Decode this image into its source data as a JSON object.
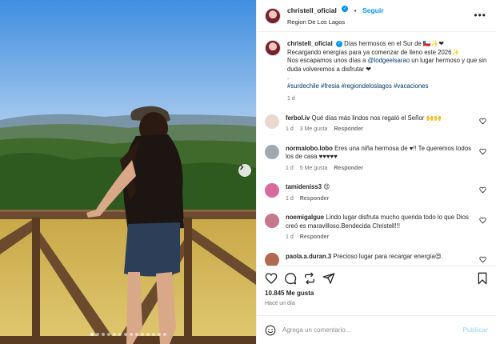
{
  "post": {
    "username": "christell_oficial",
    "follow_label": "Seguir",
    "separator": "•",
    "location": "Region De Los Lagos",
    "more_icon": "more-horizontal-icon",
    "verified_icon": "verified-badge-icon",
    "carousel": {
      "count": 14,
      "active_index": 0
    }
  },
  "caption": {
    "username": "christell_oficial",
    "text_a": "Días hermosos en el Sur de 🇨🇱✨❤",
    "text_b": "Recargando energías para ya comenzar de lleno este 2026✨",
    "text_c": "Nos escapamos unos días a ",
    "mention": "@lodgeelsarao",
    "text_d": " un lugar hermoso y que sin duda volveremos a disfrutar ❤",
    "dot": ".",
    "hashtags": "#surdechile #fresia #regiondeloslagos #vacaciones",
    "time": "1 d"
  },
  "comments": [
    {
      "user": "ferbol.iv",
      "text": "Qué días más lindos nos regaló el Señor 🙌🙌",
      "time": "1 d",
      "likes": "3 Me gusta",
      "reply": "Responder",
      "avatar_color": "#e8d8d0"
    },
    {
      "user": "normalobo.lobo",
      "text": "Eres una niña hermosa de ♥!! Te queremos todos los de casa ♥♥♥♥♥",
      "time": "1 d",
      "likes": "5 Me gusta",
      "reply": "Responder",
      "avatar_color": "#a0a8b0"
    },
    {
      "user": "tamideniss3",
      "text": "😍",
      "time": "1 d",
      "likes": "",
      "reply": "Responder",
      "avatar_color": "#d86aa0"
    },
    {
      "user": "noemigalgue",
      "text": "Lindo lugar disfruta mucho querida todo lo que Dios creó es maravilloso.Bendecida Christell!!!",
      "time": "1 d",
      "likes": "",
      "reply": "Responder",
      "avatar_color": "#c8788c"
    },
    {
      "user": "paola.a.duran.3",
      "text": "Precioso lugar para recargar energía😍.",
      "time": "",
      "likes": "",
      "reply": "",
      "avatar_color": "#b06a50"
    }
  ],
  "actions": {
    "like_icon": "heart-icon",
    "comment_icon": "comment-icon",
    "repost_icon": "repost-icon",
    "share_icon": "share-icon",
    "save_icon": "bookmark-icon"
  },
  "stats": {
    "likes": "10.845 Me gusta",
    "posted": "Hace un día"
  },
  "compose": {
    "placeholder": "Agrega un comentario...",
    "publish_label": "Publicar",
    "emoji_icon": "emoji-icon"
  },
  "colors": {
    "accent": "#0095f6",
    "link": "#00376b",
    "muted": "#737373"
  }
}
